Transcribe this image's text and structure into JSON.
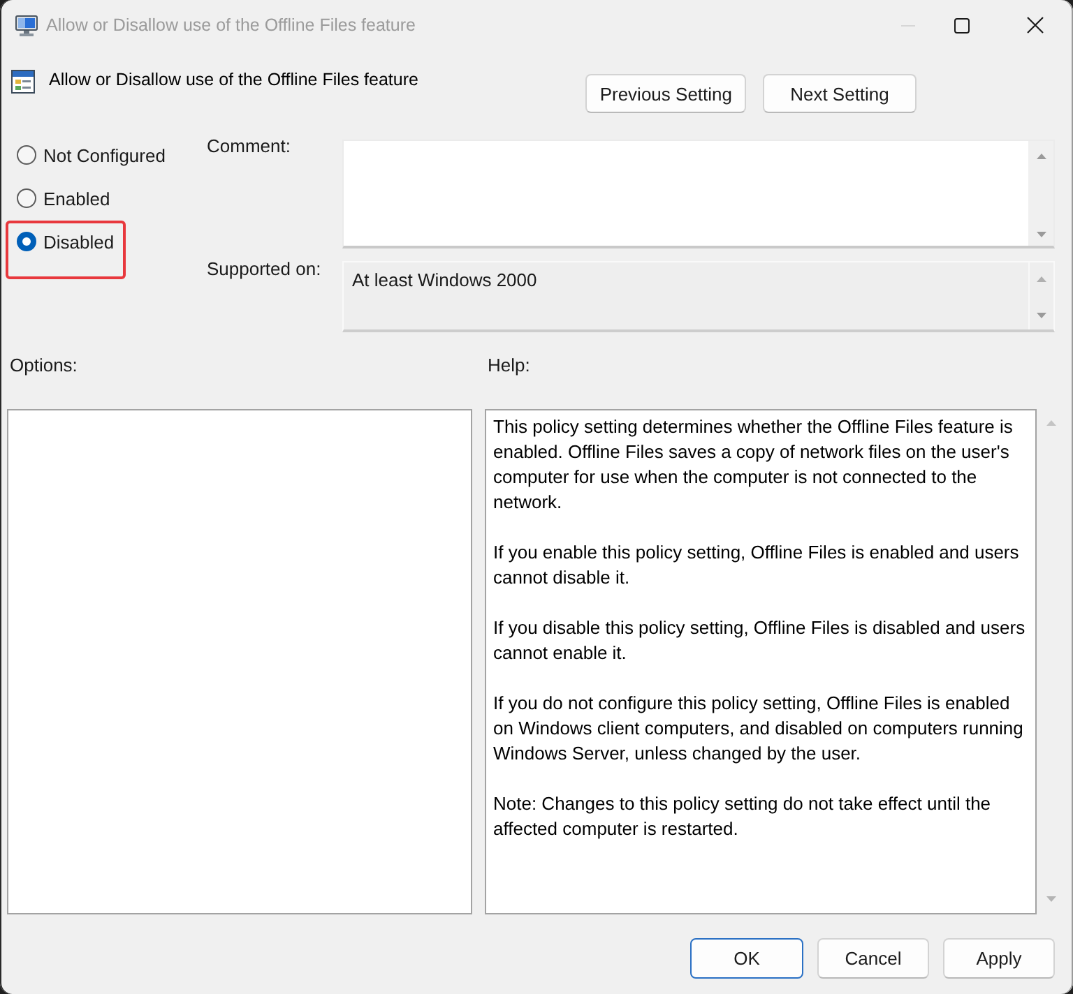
{
  "window": {
    "title": "Allow or Disallow use of the Offline Files feature",
    "active": false,
    "buttons": [
      {
        "kind": "minimize",
        "disabled": true
      },
      {
        "kind": "maximize",
        "disabled": false
      },
      {
        "kind": "close",
        "disabled": false
      }
    ]
  },
  "header": {
    "setting_name": "Allow or Disallow use of the Offline Files feature",
    "nav_buttons": [
      "Previous Setting",
      "Next Setting"
    ]
  },
  "state_options": [
    {
      "label": "Not Configured",
      "selected": false,
      "highlighted": false
    },
    {
      "label": "Enabled",
      "selected": false,
      "highlighted": false
    },
    {
      "label": "Disabled",
      "selected": true,
      "highlighted": true
    }
  ],
  "comment": {
    "label": "Comment:"
  },
  "supported_on": {
    "label": "Supported on:",
    "value": "At least Windows 2000"
  },
  "options_panel": {
    "label": "Options:"
  },
  "help_panel": {
    "label": "Help:",
    "paragraphs": [
      "This policy setting determines whether the Offline Files feature is enabled. Offline Files saves a copy of network files on the user's computer for use when the computer is not connected to the network.",
      "If you enable this policy setting, Offline Files is enabled and users cannot disable it.",
      "If you disable this policy setting, Offline Files is disabled and users cannot enable it.",
      "If you do not configure this policy setting, Offline Files is enabled on Windows client computers, and disabled on computers running Windows Server, unless changed by the user.",
      "Note: Changes to this policy setting do not take effect until the affected computer is restarted."
    ]
  },
  "dialog_buttons": [
    {
      "label": "OK",
      "default": true
    },
    {
      "label": "Cancel",
      "default": false
    },
    {
      "label": "Apply",
      "default": false
    }
  ]
}
